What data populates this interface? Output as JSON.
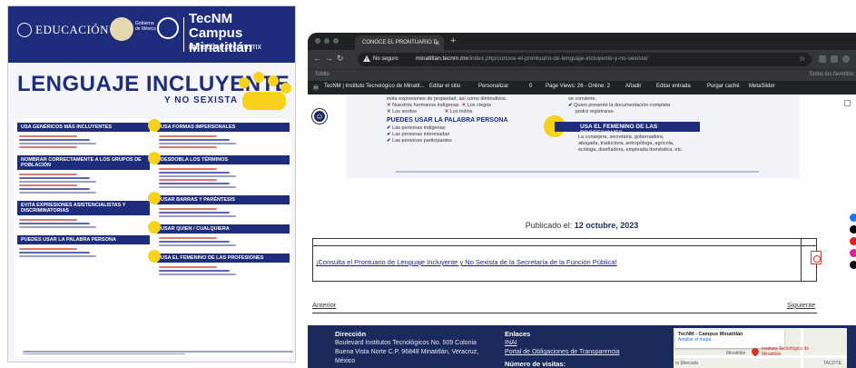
{
  "poster": {
    "org_logo": "EDUCACIÓN",
    "gov_logo_text": "Gobierno de México",
    "campus_name": "TecNM Campus Minatitlán",
    "campus_url": "minatitlan.tecnm.mx",
    "title": "LENGUAJE INCLUYENTE",
    "subtitle": "Y NO SEXISTA",
    "sections_left": [
      "USA GENÉRICOS MÁS INCLUYENTES",
      "NOMBRAR CORRECTAMENTE A LOS GRUPOS DE POBLACIÓN",
      "EVITA EXPRESIONES ASISTENCIALISTAS Y DISCRIMINATORIAS",
      "PUEDES USAR LA PALABRA PERSONA"
    ],
    "sections_right": [
      "USA FORMAS IMPERSONALES",
      "DESDOBLA LOS TÉRMINOS",
      "USAR BARRAS Y PARÉNTESIS",
      "USAR QUIEN / CUALQUIERA",
      "USA EL FEMENINO DE LAS PROFESIONES"
    ]
  },
  "browser": {
    "tab_title": "CONOCE EL PRONTUARIO D",
    "security_label": "No seguro",
    "url_host": "minatitlan.tecnm.mx",
    "url_path": "/index.php/conoce-el-prontuario-de-lenguaje-incluyente-y-no-sexista/",
    "bookmarks": {
      "left": "Tobilo",
      "right": "Todos los favoritos"
    },
    "wp_admin_bar": {
      "site": "TecNM | Instituto Tecnológico de Minatit...",
      "edit_theme": "Editar el sitio",
      "customize": "Personalizar",
      "comments": "0",
      "views": "Page Views: 26 - Online: 2",
      "add": "Añadir",
      "edit_post": "Editar entrada",
      "purge": "Purgar caché",
      "slider": "MetaSlider"
    }
  },
  "embedded_poster": {
    "top_line": "evita expresiones de propiedad, así como diminutivos.",
    "x_items": [
      "Nuestros hermanos indígenas",
      "Los sordos",
      "Los ciegos",
      "Los indios"
    ],
    "word_heading": "PUEDES USAR LA PALABRA PERSONA",
    "check_items": [
      "Las personas indígenas",
      "Las personas interesadas",
      "Las personas participantes"
    ],
    "right_top": [
      "se convierte.",
      "Quien presente la documentación completa",
      "podrá registrarse."
    ],
    "fem_heading": "USA EL FEMENINO DE LAS PROFESIONES",
    "fem_text": [
      "La consejera, secretaria, gobernadora,",
      "abogada, traductora, antropóloga, agrícola,",
      "ecóloga, diseñadora, empleada doméstica, etc."
    ]
  },
  "content": {
    "published_label": "Publicado el:",
    "published_date": "12 octubre, 2023",
    "doc_link": "¡Consulta el Prontuario de Lenguaje Incluyente y No Sexista de la Secretaría de la Función Pública!",
    "prev": "Anterior",
    "next": "Siguiente"
  },
  "footer": {
    "address_head": "Dirección",
    "address_lines": [
      "Boulevard Institutos Tecnológicos No. 509 Colonia",
      "Buena Vista Norte C.P. 96848 Minatitlán, Veracruz,",
      "México"
    ],
    "links_head": "Enlaces",
    "link_inai": "INAI",
    "link_portal": "Portal de Obligaciones de Transparencia",
    "visits_head": "Número de visitas:",
    "map_title": "TecNM - Campus Minatitlán",
    "map_link": "Ampliar el mapa",
    "map_place": "Instituto Tecnológico de Minatitlán",
    "map_city": "Minatitlán",
    "map_area": "TACOTE",
    "map_area2": "ro Mercado"
  },
  "colors": {
    "brand_navy": "#1b2a5c",
    "poster_navy": "#1e2c7c",
    "poster_yellow": "#f7d21c",
    "x_red": "#c62828"
  },
  "icons": [
    "search-icon",
    "star-icon",
    "warning-icon",
    "pdf-icon",
    "accessibility-icon",
    "facebook-icon",
    "x-icon",
    "youtube-icon",
    "instagram-icon",
    "tiktok-icon"
  ]
}
